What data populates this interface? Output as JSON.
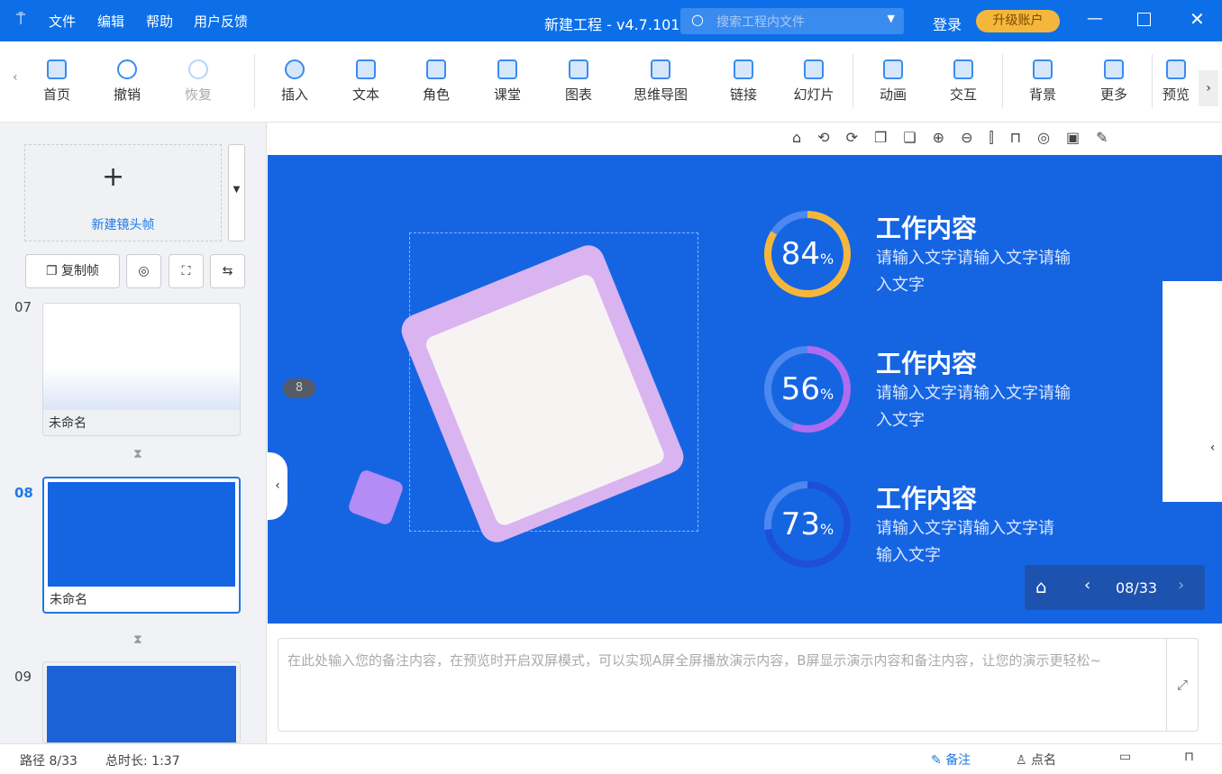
{
  "titlebar": {
    "menu": [
      "文件",
      "编辑",
      "帮助",
      "用户反馈"
    ],
    "title": "新建工程 - v4.7.101",
    "search_placeholder": "搜索工程内文件",
    "login": "登录",
    "upgrade": "升级账户"
  },
  "toolbar": {
    "items": [
      "首页",
      "撤销",
      "恢复",
      "插入",
      "文本",
      "角色",
      "课堂",
      "图表",
      "思维导图",
      "链接",
      "幻灯片",
      "动画",
      "交互",
      "背景",
      "更多",
      "预览"
    ]
  },
  "left": {
    "new_frame": "新建镜头帧",
    "copy_frame": "复制帧",
    "frames": [
      {
        "num": "07",
        "name": "未命名"
      },
      {
        "num": "08",
        "name": "未命名"
      },
      {
        "num": "09",
        "name": ""
      }
    ]
  },
  "slide": {
    "items": [
      {
        "percent": 84,
        "title": "工作内容",
        "desc": "请输入文字请输入文字请输入文字"
      },
      {
        "percent": 56,
        "title": "工作内容",
        "desc": "请输入文字请输入文字请输入文字"
      },
      {
        "percent": 73,
        "title": "工作内容",
        "desc": "请输入文字请输入文字请输入文字"
      }
    ],
    "percent_sign": "%",
    "badge": "8",
    "ring_colors": [
      "#f5b73b",
      "#b06cf0",
      "#1e4fd8"
    ]
  },
  "nav": {
    "page": "08/33"
  },
  "notes": {
    "placeholder": "在此处输入您的备注内容，在预览时开启双屏模式，可以实现A屏全屏播放演示内容，B屏显示演示内容和备注内容，让您的演示更轻松~"
  },
  "status": {
    "path": "路径 8/33",
    "duration": "总时长: 1:37",
    "notes": "备注",
    "rollcall": "点名"
  }
}
